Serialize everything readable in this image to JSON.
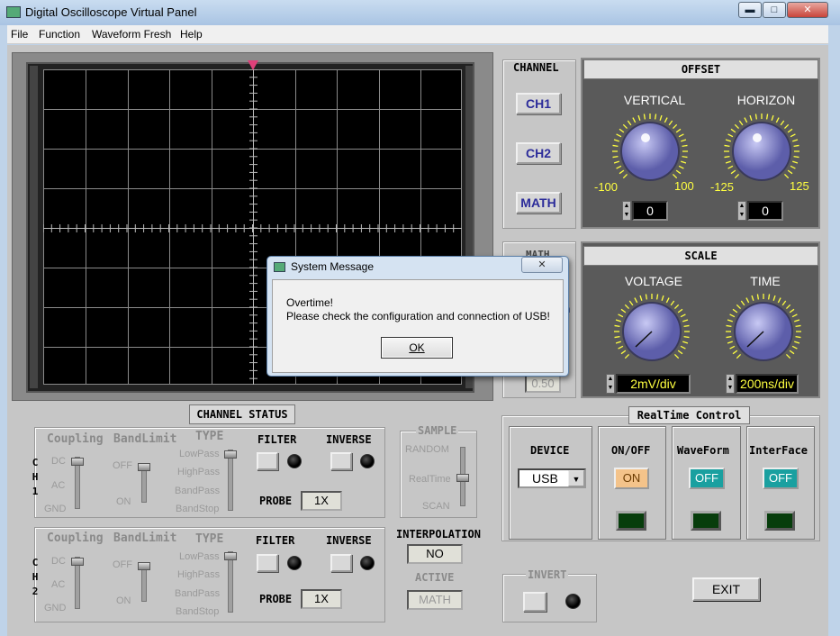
{
  "window": {
    "title": "Digital Oscilloscope Virtual Panel"
  },
  "menu": [
    "File",
    "Function",
    "Waveform Fresh",
    "Help"
  ],
  "channel": {
    "header": "CHANNEL",
    "buttons": [
      "CH1",
      "CH2",
      "MATH"
    ]
  },
  "offset": {
    "header": "OFFSET",
    "vertical": {
      "label": "VERTICAL",
      "min": "-100",
      "max": "100",
      "value": "0"
    },
    "horizon": {
      "label": "HORIZON",
      "min": "-125",
      "max": "125",
      "value": "0"
    }
  },
  "scale": {
    "header": "SCALE",
    "voltage": {
      "label": "VOLTAGE",
      "value": "2mV/div"
    },
    "time": {
      "label": "TIME",
      "value": "200ns/div"
    }
  },
  "math_partial": {
    "value": "0.50"
  },
  "channel_status": {
    "header": "CHANNEL STATUS",
    "ch1": {
      "label": [
        "C",
        "H",
        "1"
      ],
      "coupling": "Coupling",
      "coupling_opts": [
        "DC",
        "AC",
        "GND"
      ],
      "bandlimit": "BandLimit",
      "band_opts": [
        "OFF",
        "ON"
      ],
      "type": "TYPE",
      "type_opts": [
        "LowPass",
        "HighPass",
        "BandPass",
        "BandStop"
      ],
      "filter": "FILTER",
      "inverse": "INVERSE",
      "probe": "PROBE",
      "probe_value": "1X"
    },
    "ch2": {
      "label": [
        "C",
        "H",
        "2"
      ],
      "coupling": "Coupling",
      "coupling_opts": [
        "DC",
        "AC",
        "GND"
      ],
      "bandlimit": "BandLimit",
      "band_opts": [
        "OFF",
        "ON"
      ],
      "type": "TYPE",
      "type_opts": [
        "LowPass",
        "HighPass",
        "BandPass",
        "BandStop"
      ],
      "filter": "FILTER",
      "inverse": "INVERSE",
      "probe": "PROBE",
      "probe_value": "1X"
    }
  },
  "sample": {
    "header": "SAMPLE",
    "opts": [
      "RANDOM",
      "RealTime",
      "SCAN"
    ]
  },
  "interpolation": {
    "header": "INTERPOLATION",
    "value": "NO"
  },
  "active": {
    "header": "ACTIVE",
    "value": "MATH"
  },
  "realtime": {
    "header": "RealTime Control",
    "device": {
      "label": "DEVICE",
      "value": "USB"
    },
    "onoff": {
      "label": "ON/OFF",
      "value": "ON"
    },
    "waveform": {
      "label": "WaveForm",
      "value": "OFF"
    },
    "interface": {
      "label": "InterFace",
      "value": "OFF"
    }
  },
  "invert": {
    "header": "INVERT"
  },
  "exit": {
    "label": "EXIT"
  },
  "dialog": {
    "title": "System Message",
    "line1": "Overtime!",
    "line2": "Please check the configuration and connection of USB!",
    "ok": "OK",
    "close": "✕"
  },
  "partial_texts": {
    "math_head": "MATH",
    "h": "h"
  },
  "colors": {
    "screen": "#000000",
    "knob": "#8f90d8",
    "dialog_title": "#d5e3f2",
    "teal_button": "#1aa0a0",
    "on_button": "#f4c38a"
  }
}
